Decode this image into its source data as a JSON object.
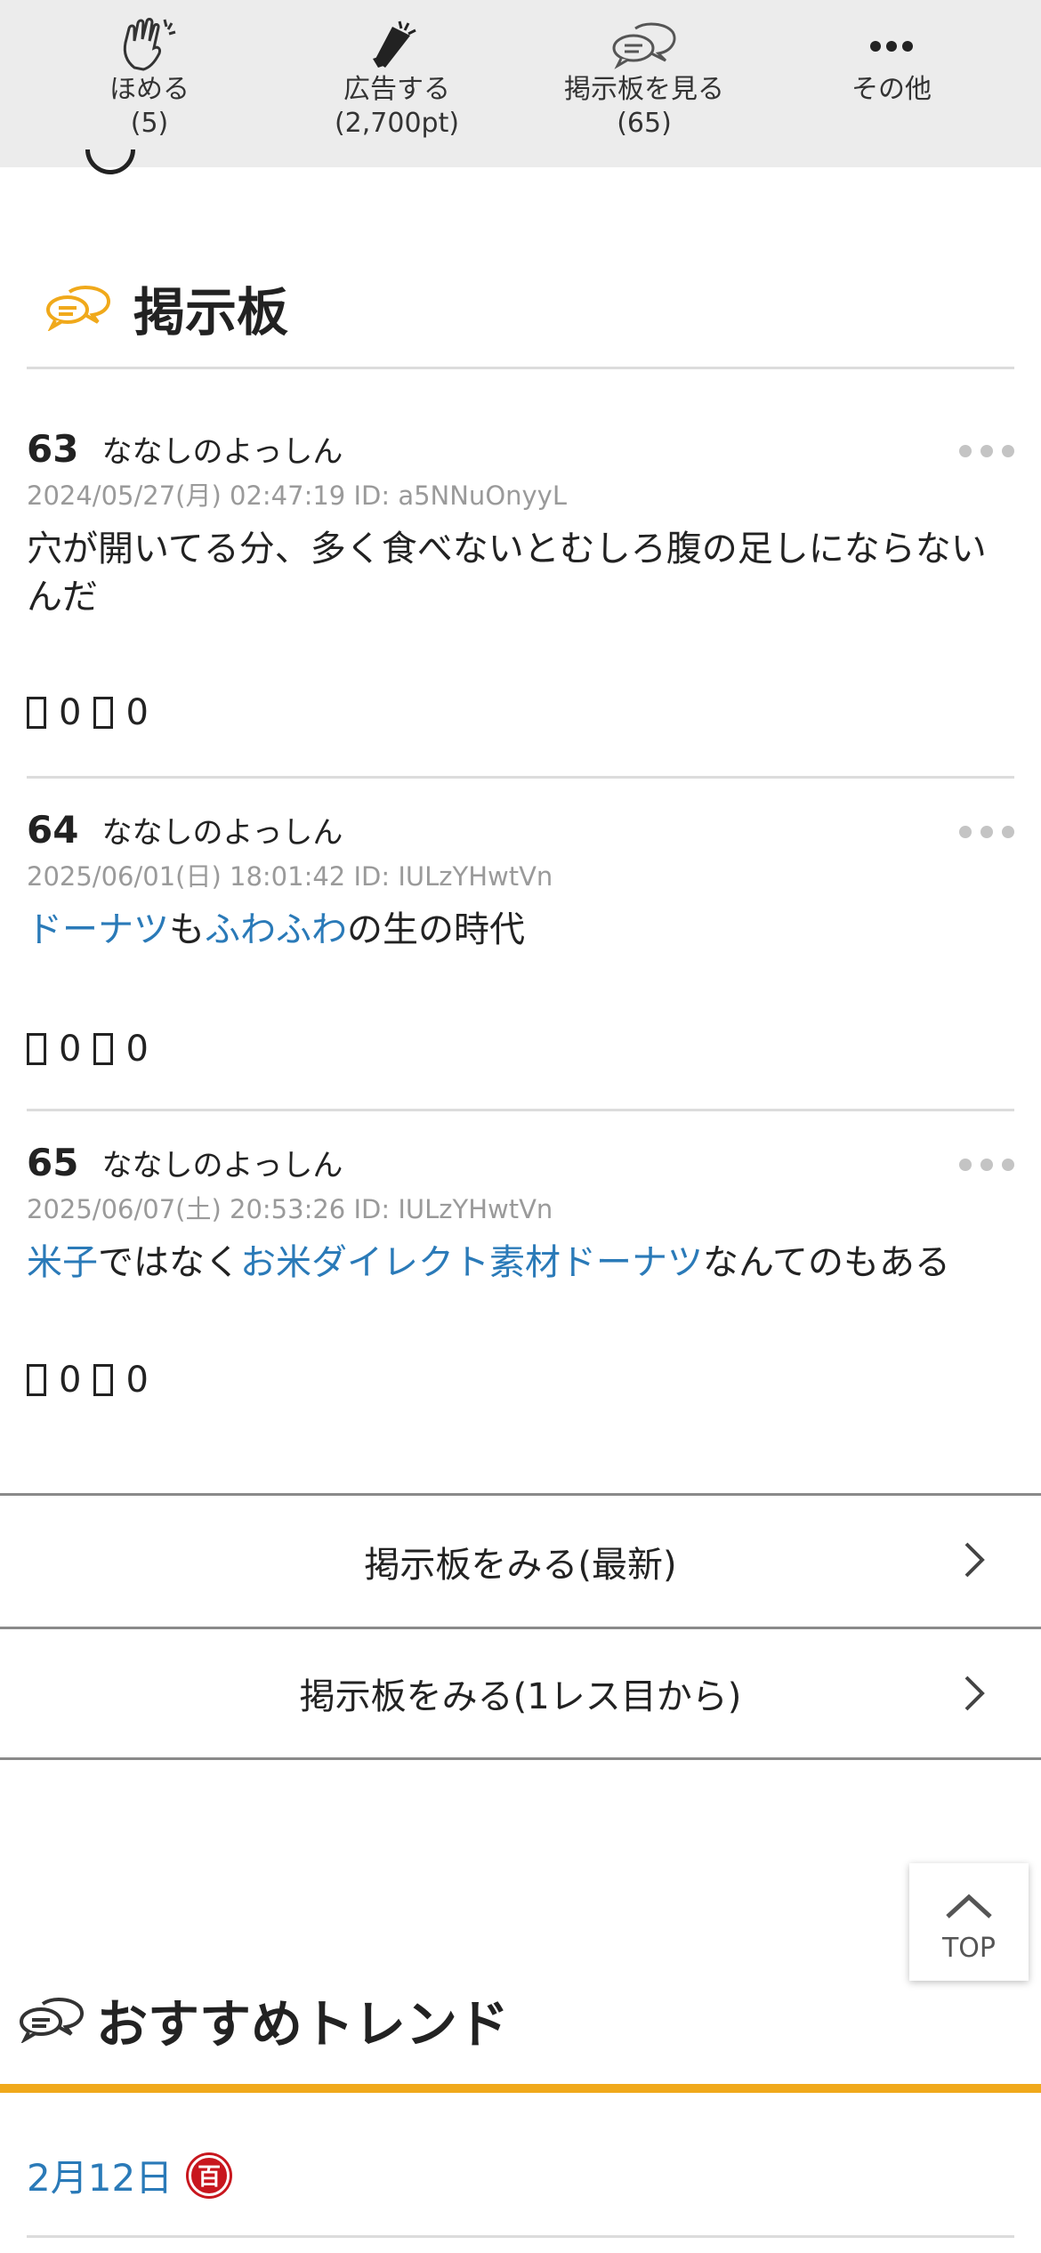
{
  "actions": [
    {
      "label": "ほめる",
      "count": "(5)",
      "icon": "clap-icon"
    },
    {
      "label": "広告する",
      "count": "(2,700pt)",
      "icon": "megaphone-icon"
    },
    {
      "label": "掲示板を見る",
      "count": "(65)",
      "icon": "chat-bubbles-icon"
    },
    {
      "label": "その他",
      "count": "",
      "icon": "more-dots-icon"
    }
  ],
  "board": {
    "title": "掲示板",
    "posts": [
      {
        "number": "63",
        "name": "ななしのよっしん",
        "meta": "2024/05/27(月) 02:47:19 ID: a5NNuOnyyL",
        "body": "穴が開いてる分、多く食べないとむしろ腹の足しにならないんだ",
        "good_count": "0",
        "bad_count": "0"
      },
      {
        "number": "64",
        "name": "ななしのよっしん",
        "meta": "2025/06/01(日) 18:01:42 ID: IULzYHwtVn",
        "body_parts": [
          "ドーナツ",
          "も",
          "ふわふわ",
          "の生の時代"
        ],
        "good_count": "0",
        "bad_count": "0"
      },
      {
        "number": "65",
        "name": "ななしのよっしん",
        "meta": "2025/06/07(土) 20:53:26 ID: IULzYHwtVn",
        "body_parts": [
          "米子",
          "ではなく",
          "お米ダイレクト素材ドーナツ",
          "なんてのもある"
        ],
        "good_count": "0",
        "bad_count": "0"
      }
    ],
    "view_latest": "掲示板をみる(最新)",
    "view_from_first": "掲示板をみる(1レス目から)"
  },
  "top_button": "TOP",
  "trends": {
    "title": "おすすめトレンド",
    "date": "2月12日",
    "badge": "百"
  },
  "colors": {
    "accent": "#f0a91b",
    "link": "#2a7ab8",
    "badge": "#c8171e"
  }
}
